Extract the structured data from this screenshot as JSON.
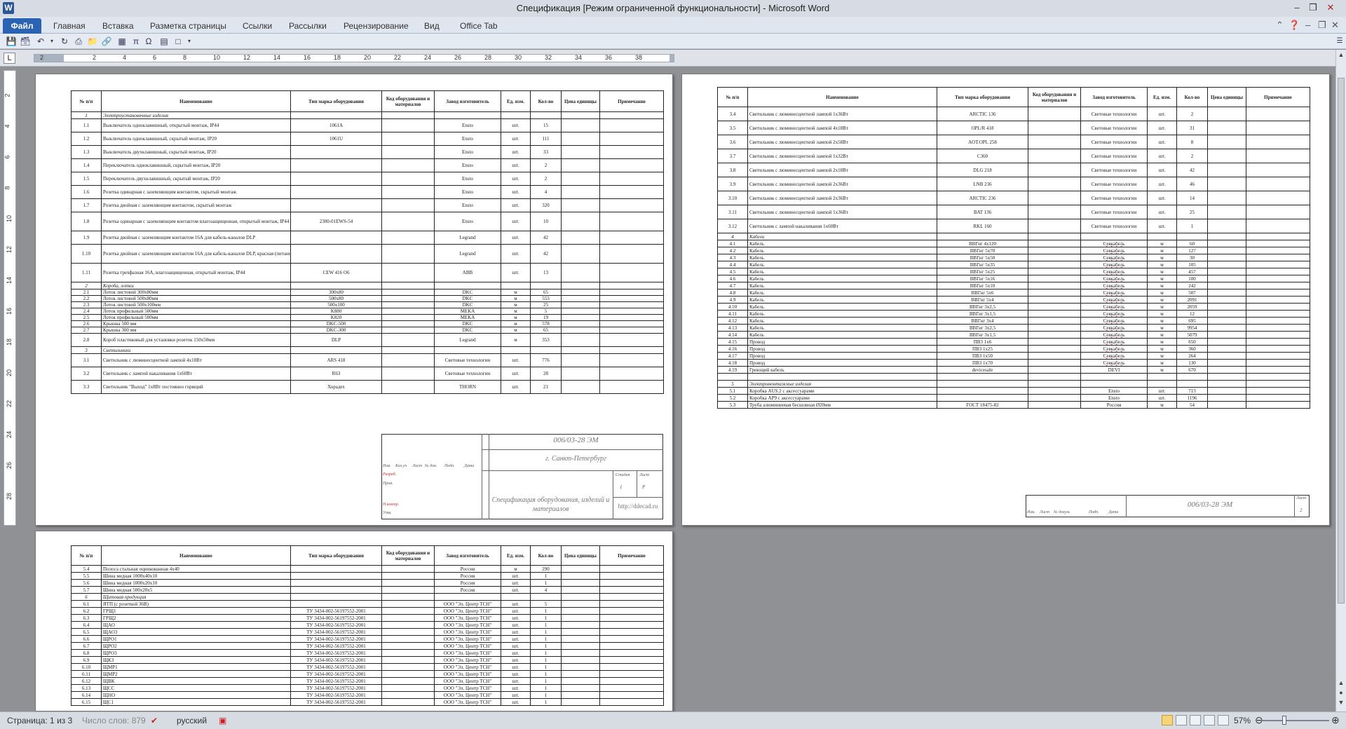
{
  "window": {
    "title": "Спецификация [Режим ограниченной функциональности]  -  Microsoft Word",
    "app_icon": "W"
  },
  "ribbon": {
    "file": "Файл",
    "tabs": [
      "Главная",
      "Вставка",
      "Разметка страницы",
      "Ссылки",
      "Рассылки",
      "Рецензирование",
      "Вид",
      "Office Tab"
    ]
  },
  "headers": [
    "№ п/п",
    "Наименование",
    "Тип марка оборудования",
    "Код оборудования и материалов",
    "Завод изготовитель",
    "Ед. изм.",
    "Кол-во",
    "Цена единицы",
    "Примечание"
  ],
  "ruler": {
    "h": [
      "2",
      "2",
      "4",
      "6",
      "8",
      "10",
      "12",
      "14",
      "16",
      "18",
      "20",
      "22",
      "24",
      "26",
      "28",
      "30",
      "32",
      "34",
      "36",
      "38"
    ],
    "v": [
      "2",
      "4",
      "6",
      "8",
      "10",
      "12",
      "14",
      "16",
      "18",
      "20",
      "22",
      "24",
      "26",
      "28"
    ]
  },
  "page1": [
    [
      "1",
      "Электроустановочные изделия",
      "",
      "",
      "",
      "",
      "",
      "sec"
    ],
    [
      "1.1",
      "Выключатель одноклавишный, открытый монтаж, IP44",
      "1061A",
      "",
      "Ensto",
      "шт.",
      "15",
      ""
    ],
    [
      "1.2",
      "Выключатель одноклавишный, скрытый монтаж, IP20",
      "1061U",
      "",
      "Ensto",
      "шт.",
      "111",
      ""
    ],
    [
      "1.3",
      "Выключатель двухклавишный, скрытый монтаж, IP20",
      "",
      "",
      "Ensto",
      "шт.",
      "33",
      ""
    ],
    [
      "1.4",
      "Переключатель одноклавишный, скрытый монтаж, IP20",
      "",
      "",
      "Ensto",
      "шт.",
      "2",
      ""
    ],
    [
      "1.5",
      "Переключатель двухклавишный, скрытый монтаж, IP20",
      "",
      "",
      "Ensto",
      "шт.",
      "2",
      ""
    ],
    [
      "1.6",
      "Розетка одинарная с заземляющим контактом, скрытый монтаж",
      "",
      "",
      "Ensto",
      "шт.",
      "4",
      ""
    ],
    [
      "1.7",
      "Розетка двойная с заземляющим контактом, скрытый монтаж",
      "",
      "",
      "Ensto",
      "шт.",
      "320",
      ""
    ],
    [
      "1.8",
      "Розетка одинарная с заземляющим контактом влагозащищенная, открытый монтаж, IP44",
      "2300-01EWS-54",
      "",
      "Ensto",
      "шт.",
      "10",
      ""
    ],
    [
      "1.9",
      "Розетка двойная с заземляющим контактом 16А для кабель-каналов DLP",
      "",
      "",
      "Legrand",
      "шт.",
      "42",
      ""
    ],
    [
      "1.10",
      "Розетка двойная с заземляющим контактом 16А для кабель-каналов DLP, красная (питание компьютерной сети)",
      "",
      "",
      "Legrand",
      "шт.",
      "42",
      ""
    ],
    [
      "1.11",
      "Розетка трехфазная 16А, влагозащищенная, открытый монтаж, IP44",
      "CEW 416 O6",
      "",
      "ABB",
      "шт.",
      "13",
      ""
    ],
    [
      "2",
      "Короба, лотки",
      "",
      "",
      "",
      "",
      "",
      "sec"
    ],
    [
      "2.1",
      "Лоток листовой 300x80мм",
      "300x80",
      "",
      "DKC",
      "м",
      "65",
      ""
    ],
    [
      "2.2",
      "Лоток листовой 500x80мм",
      "500x80",
      "",
      "DKC",
      "м",
      "553",
      ""
    ],
    [
      "2.3",
      "Лоток листовой 500x100мм",
      "500x100",
      "",
      "DKC",
      "м",
      "25",
      ""
    ],
    [
      "2.4",
      "Лоток профильный 500мм",
      "K880",
      "",
      "MEKA",
      "м",
      "5",
      ""
    ],
    [
      "2.5",
      "Лоток профильный 500мм",
      "K820",
      "",
      "MEKA",
      "м",
      "19",
      ""
    ],
    [
      "2.6",
      "Крышка 500 мм",
      "DKC-500",
      "",
      "DKC",
      "м",
      "578",
      ""
    ],
    [
      "2.7",
      "Крышка 300 мм",
      "DKC-300",
      "",
      "DKC",
      "м",
      "65",
      ""
    ],
    [
      "2.8",
      "Короб пластиковый для установки розеток 150x50мм",
      "DLP",
      "",
      "Legrand",
      "м",
      "353",
      ""
    ],
    [
      "3",
      "Светильники",
      "",
      "",
      "",
      "",
      "",
      "sec"
    ],
    [
      "3.1",
      "Светильник с люминесцентной лампой 4x18Вт",
      "ARS 418",
      "",
      "Световые технологии",
      "шт.",
      "776",
      ""
    ],
    [
      "3.2",
      "Светильник с лампой накаливания 1x60Вт",
      "R63",
      "",
      "Световые технологии",
      "шт.",
      "28",
      ""
    ],
    [
      "3.3",
      "Светильник \"Выход\" 1x8Вт постоянно горящий",
      "Хорадех",
      "",
      "THORN",
      "шт.",
      "21",
      ""
    ]
  ],
  "page2": [
    [
      "3.4",
      "Светильник с люминесцентной лампой 1x36Вт",
      "ARCTIC 136",
      "",
      "Световые технологии",
      "шт.",
      "2",
      ""
    ],
    [
      "3.5",
      "Светильник с люминесцентной лампой 4x18Вт",
      "OPL/R 418",
      "",
      "Световые технологии",
      "шт.",
      "31",
      ""
    ],
    [
      "3.6",
      "Светильник с люминесцентной лампой 2x58Вт",
      "AOT.OPL 258",
      "",
      "Световые технологии",
      "шт.",
      "8",
      ""
    ],
    [
      "3.7",
      "Светильник с люминесцентной лампой 1x32Вт",
      "C360",
      "",
      "Световые технологии",
      "шт.",
      "2",
      ""
    ],
    [
      "3.8",
      "Светильник с люминесцентной лампой 2x18Вт",
      "DLG 218",
      "",
      "Световые технологии",
      "шт.",
      "42",
      ""
    ],
    [
      "3.9",
      "Светильник с люминесцентной лампой 2x36Вт",
      "LNB 236",
      "",
      "Световые технологии",
      "шт.",
      "46",
      ""
    ],
    [
      "3.10",
      "Светильник с люминесцентной лампой 2x36Вт",
      "ARCTIC 236",
      "",
      "Световые технологии",
      "шт.",
      "14",
      ""
    ],
    [
      "3.11",
      "Светильник с люминесцентной лампой 1x36Вт",
      "BAT 136",
      "",
      "Световые технологии",
      "шт.",
      "25",
      ""
    ],
    [
      "3.12",
      "Светильник с лампой накаливания 1x60Вт",
      "RKL 160",
      "",
      "Световые технологии",
      "шт.",
      "1",
      ""
    ],
    [
      "4",
      "Кабели",
      "",
      "",
      "",
      "",
      "",
      "sec"
    ],
    [
      "4.1",
      "Кабель",
      "ВВГнг 4x120",
      "",
      "Севкабель",
      "м",
      "60",
      ""
    ],
    [
      "4.2",
      "Кабель",
      "ВВГнг 5x70",
      "",
      "Севкабель",
      "м",
      "127",
      ""
    ],
    [
      "4.3",
      "Кабель",
      "ВВГнг 5x50",
      "",
      "Севкабель",
      "м",
      "30",
      ""
    ],
    [
      "4.4",
      "Кабель",
      "ВВГнг 5x35",
      "",
      "Севкабель",
      "м",
      "105",
      ""
    ],
    [
      "4.5",
      "Кабель",
      "ВВГнг 5x25",
      "",
      "Севкабель",
      "м",
      "457",
      ""
    ],
    [
      "4.6",
      "Кабель",
      "ВВГнг 5x16",
      "",
      "Севкабель",
      "м",
      "100",
      ""
    ],
    [
      "4.7",
      "Кабель",
      "ВВГнг 5x10",
      "",
      "Севкабель",
      "м",
      "242",
      ""
    ],
    [
      "4.8",
      "Кабель",
      "ВВГнг 5x6",
      "",
      "Севкабель",
      "м",
      "507",
      ""
    ],
    [
      "4.9",
      "Кабель",
      "ВВГнг 5x4",
      "",
      "Севкабель",
      "м",
      "2091",
      ""
    ],
    [
      "4.10",
      "Кабель",
      "ВВГнг 3x2,5",
      "",
      "Севкабель",
      "м",
      "2059",
      ""
    ],
    [
      "4.11",
      "Кабель",
      "ВВГнг 3x1,5",
      "",
      "Севкабель",
      "м",
      "12",
      ""
    ],
    [
      "4.12",
      "Кабель",
      "ВВГнг 3x4",
      "",
      "Севкабель",
      "м",
      "695",
      ""
    ],
    [
      "4.13",
      "Кабель",
      "ВВГнг 3x2,5",
      "",
      "Севкабель",
      "м",
      "9954",
      ""
    ],
    [
      "4.14",
      "Кабель",
      "ВВГнг 3x1,5",
      "",
      "Севкабель",
      "м",
      "5079",
      ""
    ],
    [
      "4.15",
      "Провод",
      "ПВ3 1x6",
      "",
      "Севкабель",
      "м",
      "650",
      ""
    ],
    [
      "4.16",
      "Провод",
      "ПВ3 1x25",
      "",
      "Севкабель",
      "м",
      "360",
      ""
    ],
    [
      "4.17",
      "Провод",
      "ПВ3 1x50",
      "",
      "Севкабель",
      "м",
      "264",
      ""
    ],
    [
      "4.18",
      "Провод",
      "ПВ3 1x70",
      "",
      "Севкабель",
      "м",
      "130",
      ""
    ],
    [
      "4.19",
      "Греющий кабель",
      "devicesafe",
      "",
      "DEVI",
      "м",
      "670",
      ""
    ],
    [
      "",
      "",
      "",
      "",
      "",
      "",
      "",
      ""
    ],
    [
      "5",
      "Электромонтажные изделия",
      "",
      "",
      "",
      "",
      "",
      "sec"
    ],
    [
      "5.1",
      "Коробка AUS.2 с аксессуарами",
      "",
      "",
      "Ensto",
      "шт.",
      "713",
      ""
    ],
    [
      "5.2",
      "Коробка AP9 с аксессуарами",
      "",
      "",
      "Ensto",
      "шт.",
      "1196",
      ""
    ],
    [
      "5.3",
      "Труба алюминиевая бесшовная Ø20мм",
      "ГОСТ 18475-82",
      "",
      "Россия",
      "м",
      "54",
      ""
    ]
  ],
  "page3": [
    [
      "5.4",
      "Полоса стальная оцинкованная 4x40",
      "",
      "",
      "Россия",
      "м",
      "290",
      ""
    ],
    [
      "5.5",
      "Шина медная 1000x40x10",
      "",
      "",
      "Россия",
      "шт.",
      "1",
      ""
    ],
    [
      "5.6",
      "Шина медная 1000x20x10",
      "",
      "",
      "Россия",
      "шт.",
      "1",
      ""
    ],
    [
      "5.7",
      "Шина медная 500x20x5",
      "",
      "",
      "Россия",
      "шт.",
      "4",
      ""
    ],
    [
      "6",
      "Щитовая продукция",
      "",
      "",
      "",
      "",
      "",
      "sec"
    ],
    [
      "6.1",
      "ЯТП (с розеткой 36В)",
      "",
      "",
      "ООО \"Эл. Центр ТСН\"",
      "шт.",
      "5",
      ""
    ],
    [
      "6.2",
      "ГРЩ1",
      "ТУ 3434-002-56197552-2001",
      "",
      "ООО \"Эл. Центр ТСН\"",
      "шт.",
      "1",
      ""
    ],
    [
      "6.3",
      "ГРЩ2",
      "ТУ 3434-002-56197552-2001",
      "",
      "ООО \"Эл. Центр ТСН\"",
      "шт.",
      "1",
      ""
    ],
    [
      "6.4",
      "ЩАО",
      "ТУ 3434-002-56197552-2001",
      "",
      "ООО \"Эл. Центр ТСН\"",
      "шт.",
      "1",
      ""
    ],
    [
      "6.5",
      "ЩАО3",
      "ТУ 3434-002-56197552-2001",
      "",
      "ООО \"Эл. Центр ТСН\"",
      "шт.",
      "1",
      ""
    ],
    [
      "6.6",
      "ЩРО1",
      "ТУ 3434-002-56197552-2001",
      "",
      "ООО \"Эл. Центр ТСН\"",
      "шт.",
      "1",
      ""
    ],
    [
      "6.7",
      "ЩРО2",
      "ТУ 3434-002-56197552-2001",
      "",
      "ООО \"Эл. Центр ТСН\"",
      "шт.",
      "1",
      ""
    ],
    [
      "6.8",
      "ЩРО3",
      "ТУ 3434-002-56197552-2001",
      "",
      "ООО \"Эл. Центр ТСН\"",
      "шт.",
      "1",
      ""
    ],
    [
      "6.9",
      "ЩК3",
      "ТУ 3434-002-56197552-2001",
      "",
      "ООО \"Эл. Центр ТСН\"",
      "шт.",
      "1",
      ""
    ],
    [
      "6.10",
      "ЩМР1",
      "ТУ 3434-002-56197552-2001",
      "",
      "ООО \"Эл. Центр ТСН\"",
      "шт.",
      "1",
      ""
    ],
    [
      "6.11",
      "ЩМР2",
      "ТУ 3434-002-56197552-2001",
      "",
      "ООО \"Эл. Центр ТСН\"",
      "шт.",
      "1",
      ""
    ],
    [
      "6.12",
      "ЩВК",
      "ТУ 3434-002-56197552-2001",
      "",
      "ООО \"Эл. Центр ТСН\"",
      "шт.",
      "1",
      ""
    ],
    [
      "6.13",
      "ЩСС",
      "ТУ 3434-002-56197552-2001",
      "",
      "ООО \"Эл. Центр ТСН\"",
      "шт.",
      "1",
      ""
    ],
    [
      "6.14",
      "ЩНО",
      "ТУ 3434-002-56197552-2001",
      "",
      "ООО \"Эл. Центр ТСН\"",
      "шт.",
      "1",
      ""
    ],
    [
      "6.15",
      "ЩС1",
      "ТУ 3434-002-56197552-2001",
      "",
      "ООО \"Эл. Центр ТСН\"",
      "шт.",
      "1",
      ""
    ]
  ],
  "stamp1": {
    "code": "006/03-28 ЭМ",
    "city": "г. Санкт-Петербург",
    "title": "Спецификация оборудования, изделий и материалов",
    "url": "http://ddecad.ru",
    "cols": [
      "Изм.",
      "Кол.уч",
      "Лист",
      "№ док.",
      "Подп.",
      "Дата"
    ],
    "roles": [
      "Разраб.",
      "Пров.",
      "Н.контр.",
      "Утв."
    ],
    "heads": [
      "Стадия",
      "Лист",
      "Листов"
    ],
    "vals": [
      "Р",
      "1",
      "3"
    ]
  },
  "stamp2": {
    "code": "006/03-28 ЭМ",
    "cols": [
      "Изм.",
      "Лист",
      "№ докум.",
      "Подп.",
      "Дата"
    ],
    "sheet_label": "Лист",
    "sheet_num": "2"
  },
  "status": {
    "page": "Страница: 1 из 3",
    "words": "Число слов: 879",
    "lang": "русский",
    "zoom": "57%",
    "zoom_level": 0.57
  }
}
